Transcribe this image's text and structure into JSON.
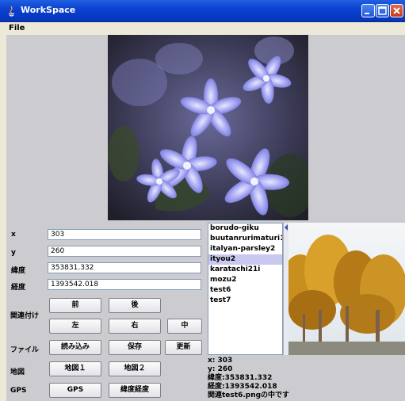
{
  "window": {
    "title": "WorkSpace"
  },
  "menu": {
    "file": "File"
  },
  "fields": {
    "x": {
      "label": "x",
      "value": "303"
    },
    "y": {
      "label": "y",
      "value": "260"
    },
    "lat": {
      "label": "緯度",
      "value": "353831.332"
    },
    "lon": {
      "label": "経度",
      "value": "1393542.018"
    }
  },
  "sections": {
    "association": "関連付け",
    "file": "ファイル",
    "map": "地図",
    "gps": "GPS"
  },
  "buttons": {
    "prev": "前",
    "next": "後",
    "left": "左",
    "right": "右",
    "center": "中",
    "load": "読み込み",
    "save": "保存",
    "update": "更新",
    "map1": "地図１",
    "map2": "地図２",
    "gps": "GPS",
    "latlon": "緯度経度"
  },
  "list": {
    "items": [
      "borudo-giku",
      "buutanrurimaturi11i",
      "italyan-parsley2",
      "ityou2",
      "karatachi21i",
      "mozu2",
      "test6",
      "test7"
    ],
    "selected_index": 3
  },
  "info": {
    "x": "x:   303",
    "y": "y:   260",
    "lat": "緯度:353831.332",
    "lon": "経度:1393542.018",
    "status": "関連test6.pngの中です"
  },
  "colors": {
    "titlebar": "#0a3fd0",
    "selection": "#c8c8f0"
  }
}
